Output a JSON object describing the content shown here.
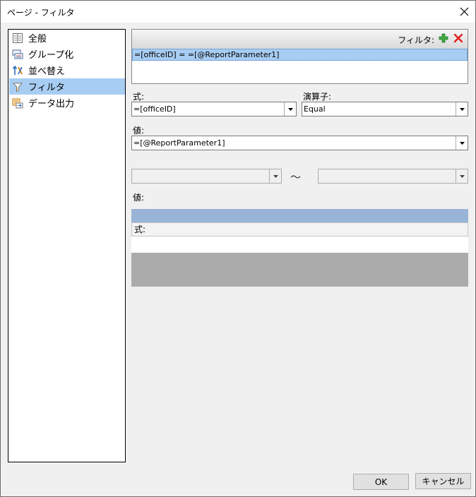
{
  "window": {
    "title": "ページ - フィルタ"
  },
  "nav": {
    "items": [
      {
        "label": "全般",
        "icon": "properties-icon"
      },
      {
        "label": "グループ化",
        "icon": "grouping-icon"
      },
      {
        "label": "並べ替え",
        "icon": "sort-icon"
      },
      {
        "label": "フィルタ",
        "icon": "filter-icon",
        "selected": true
      },
      {
        "label": "データ出力",
        "icon": "data-output-icon"
      }
    ]
  },
  "filter": {
    "header_label": "フィルタ:",
    "rows": [
      "=[officeID] = =[@ReportParameter1]"
    ]
  },
  "expression": {
    "label": "式:",
    "value": "=[officeID]"
  },
  "operator": {
    "label": "演算子:",
    "value": "Equal"
  },
  "value": {
    "label": "値:",
    "value": "=[@ReportParameter1]"
  },
  "range": {
    "from": "",
    "to": "",
    "separator": "～"
  },
  "values_list": {
    "label": "値:",
    "column_header": "式:"
  },
  "buttons": {
    "ok": "OK",
    "cancel": "キャンセル"
  },
  "colors": {
    "selection": "#a8cdf2",
    "add": "#3fa83f",
    "remove": "#e02020"
  }
}
